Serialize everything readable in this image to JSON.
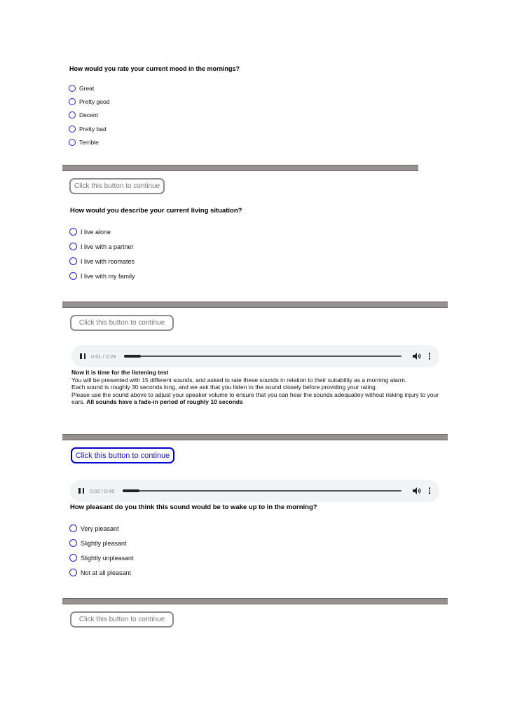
{
  "section1": {
    "question": "How would you rate your current mood in the mornings?",
    "options": [
      "Great",
      "Pretty good",
      "Decent",
      "Pretty bad",
      "Terrible"
    ]
  },
  "continue_label": "Click this button to continue",
  "section2": {
    "question": "How would you describe your current living situation?",
    "options": [
      "I live alone",
      "I live with a partner",
      "I live with roomates",
      "I live with my family"
    ]
  },
  "audio1": {
    "time": "0:01 / 0:29",
    "progress": 0.06
  },
  "intro": {
    "heading": "Now it is time for the listening test",
    "line1": "You will be presented with 15 different sounds, and asked to rate these sounds in relation to their suitability as a morning alarm.",
    "line2": "Each sound is roughly 30 seconds long, and we ask that you listen to the sound closely before providing your rating.",
    "line3": "Please use the sound above to adjust your speaker volume to ensure that you can hear the sounds adequatley without risking injury to your ears.",
    "line3_bold": "All sounds have a fade-in period of roughly 10 seconds"
  },
  "audio2": {
    "time": "0:02 / 0:45",
    "progress": 0.06
  },
  "section3": {
    "question": "How pleasant do you think this sound would be to wake up to in the morning?",
    "options": [
      "Very pleasant",
      "Slightly pleasant",
      "Slightly unpleasant",
      "Not at all pleasant"
    ]
  },
  "colors": {
    "radio": "#1f1fd6",
    "divider": "#969090",
    "button_active": "#0000cc",
    "button_inactive": "#8c8c8c"
  },
  "icons": {
    "pause": "pause-icon",
    "volume": "volume-icon",
    "more": "more-options-icon"
  }
}
